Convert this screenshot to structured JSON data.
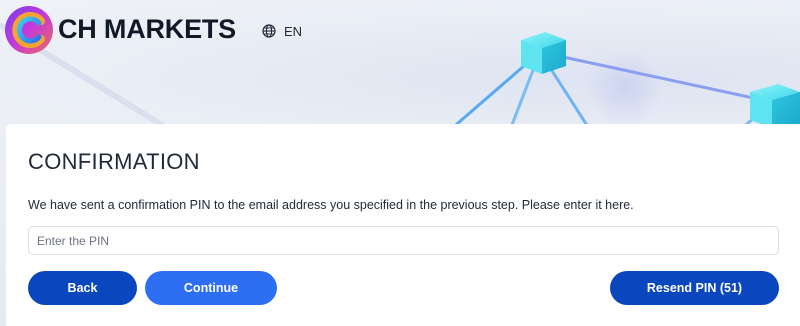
{
  "header": {
    "brand_name": "CH MARKETS",
    "logo_icon": "ch-markets-logo",
    "language": {
      "icon": "globe-icon",
      "label": "EN"
    }
  },
  "confirmation": {
    "title": "CONFIRMATION",
    "description": "We have sent a confirmation PIN to the email address you specified in the previous step. Please enter it here.",
    "pin_input": {
      "placeholder": "Enter the PIN",
      "value": ""
    },
    "buttons": {
      "back_label": "Back",
      "continue_label": "Continue",
      "resend_label": "Resend PIN (51)"
    }
  },
  "colors": {
    "primary_dark": "#0a47be",
    "primary_light": "#2e6ef3",
    "accent_cyan": "#40e0ee"
  }
}
